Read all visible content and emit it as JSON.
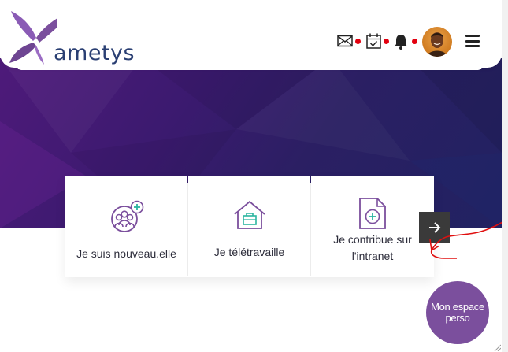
{
  "header": {
    "logo_text": "ametys",
    "icons": {
      "mail": "envelope-icon",
      "calendar": "calendar-check-icon",
      "bell": "bell-icon",
      "menu": "hamburger-menu-icon"
    },
    "notification_dot_color": "#e3000f"
  },
  "cards": [
    {
      "label": "Je suis nouveau.elle",
      "icon": "people-add-icon"
    },
    {
      "label": "Je télétravaille",
      "icon": "house-briefcase-icon"
    },
    {
      "label_line1": "Je contribue sur",
      "label_line2": "l'intranet",
      "icon": "document-add-icon"
    }
  ],
  "carousel": {
    "next_icon": "arrow-right-icon"
  },
  "fab": {
    "line1": "Mon espace",
    "line2": "perso"
  },
  "colors": {
    "brand_purple": "#7b4f9d",
    "logo_navy": "#2a3f73",
    "accent_teal": "#2bb5a0",
    "hero_dark": "#2b1f63",
    "annotation_red": "#e01010"
  }
}
